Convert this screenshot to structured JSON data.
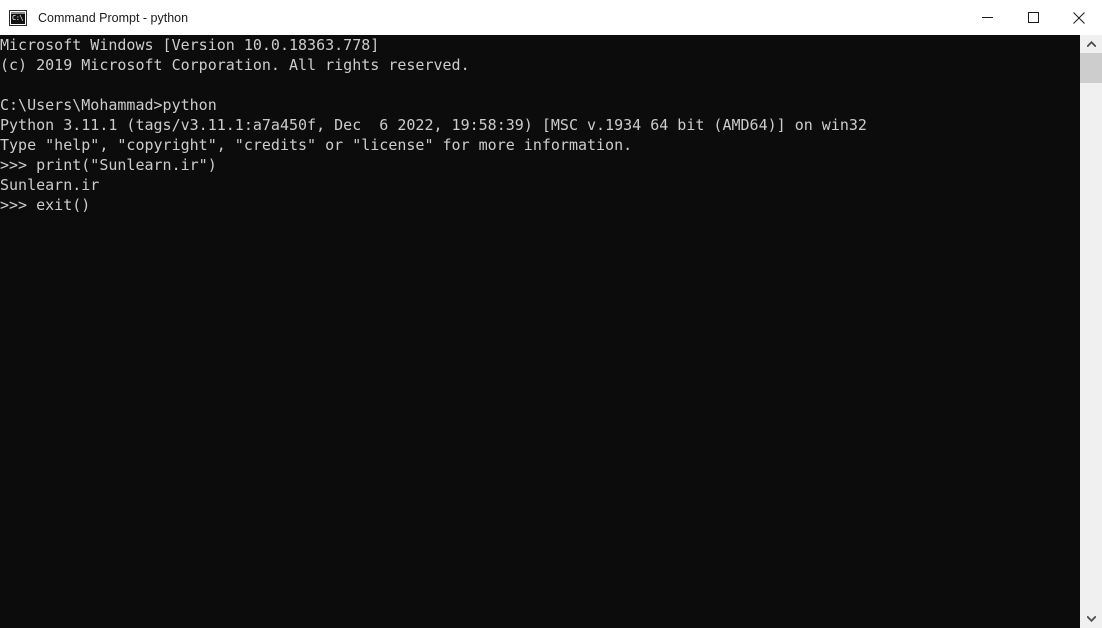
{
  "window": {
    "title": "Command Prompt - python",
    "app_icon": "cmd-console-icon",
    "icon_glyph": "C:\\",
    "background_color": "#0c0c0c",
    "text_color": "#cccccc",
    "titlebar_color": "#ffffff"
  },
  "controls": {
    "minimize_label": "Minimize",
    "maximize_label": "Maximize",
    "close_label": "Close"
  },
  "terminal": {
    "lines": [
      "Microsoft Windows [Version 10.0.18363.778]",
      "(c) 2019 Microsoft Corporation. All rights reserved.",
      "",
      "C:\\Users\\Mohammad>python",
      "Python 3.11.1 (tags/v3.11.1:a7a450f, Dec  6 2022, 19:58:39) [MSC v.1934 64 bit (AMD64)] on win32",
      "Type \"help\", \"copyright\", \"credits\" or \"license\" for more information.",
      ">>> print(\"Sunlearn.ir\")",
      "Sunlearn.ir",
      ">>> exit()"
    ],
    "content": "Microsoft Windows [Version 10.0.18363.778]\n(c) 2019 Microsoft Corporation. All rights reserved.\n\nC:\\Users\\Mohammad>python\nPython 3.11.1 (tags/v3.11.1:a7a450f, Dec  6 2022, 19:58:39) [MSC v.1934 64 bit (AMD64)] on win32\nType \"help\", \"copyright\", \"credits\" or \"license\" for more information.\n>>> print(\"Sunlearn.ir\")\nSunlearn.ir\n>>> exit()"
  },
  "scrollbar": {
    "up_arrow": "chevron-up-icon",
    "down_arrow": "chevron-down-icon",
    "track_color": "#f0f0f0",
    "thumb_color": "#cdcdcd"
  }
}
